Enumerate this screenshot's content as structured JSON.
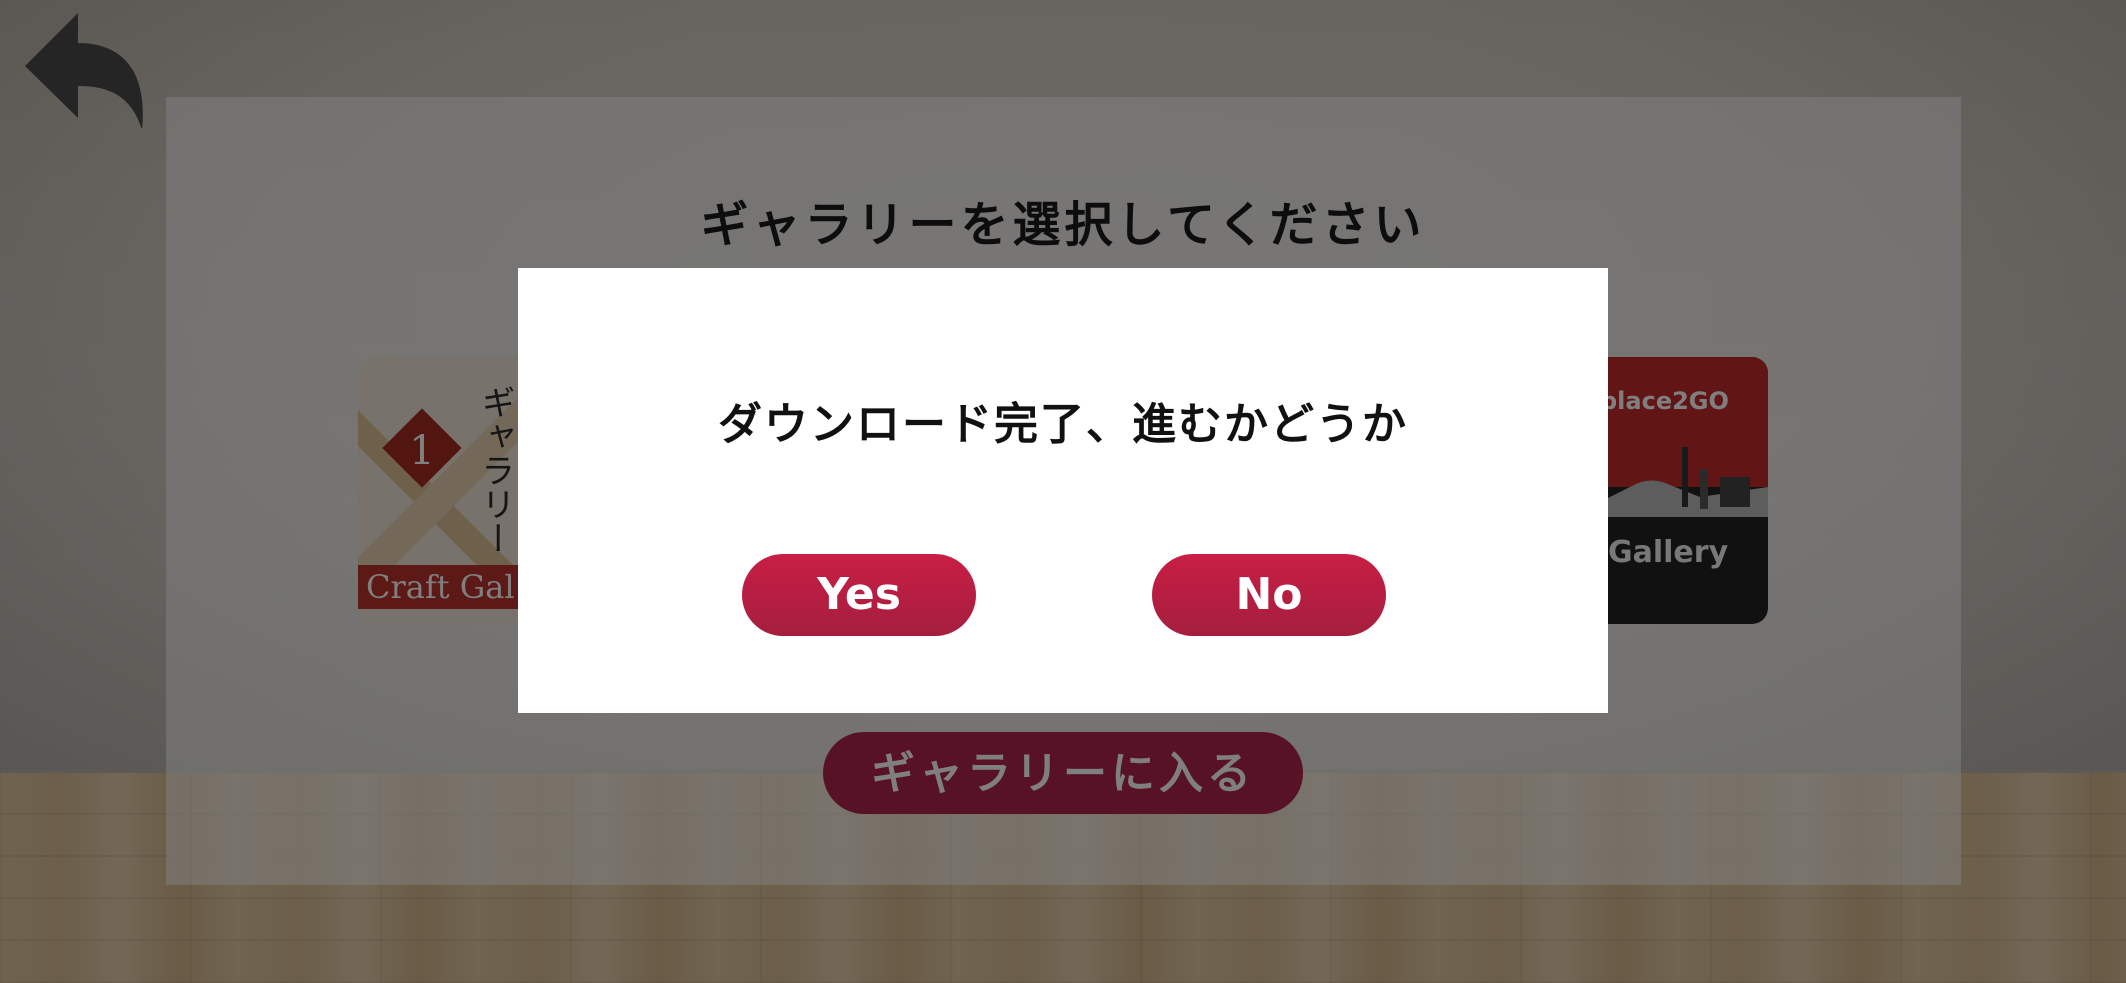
{
  "header": {
    "back_icon": "undo-arrow-icon"
  },
  "panel": {
    "title": "ギャラリーを選択してください",
    "cards": [
      {
        "number": "1",
        "vertical_text": "ギャラリー",
        "band_text": "Craft Gal"
      },
      {
        "brand": "place2GO",
        "bottom_text": "Gallery"
      }
    ],
    "enter_label": "ギャラリーに入る"
  },
  "dialog": {
    "message": "ダウンロード完了、進むかどうか",
    "yes_label": "Yes",
    "no_label": "No"
  },
  "colors": {
    "accent": "#b8224a",
    "dialog_bg": "#ffffff",
    "overlay": "rgba(0,0,0,0.5)"
  }
}
